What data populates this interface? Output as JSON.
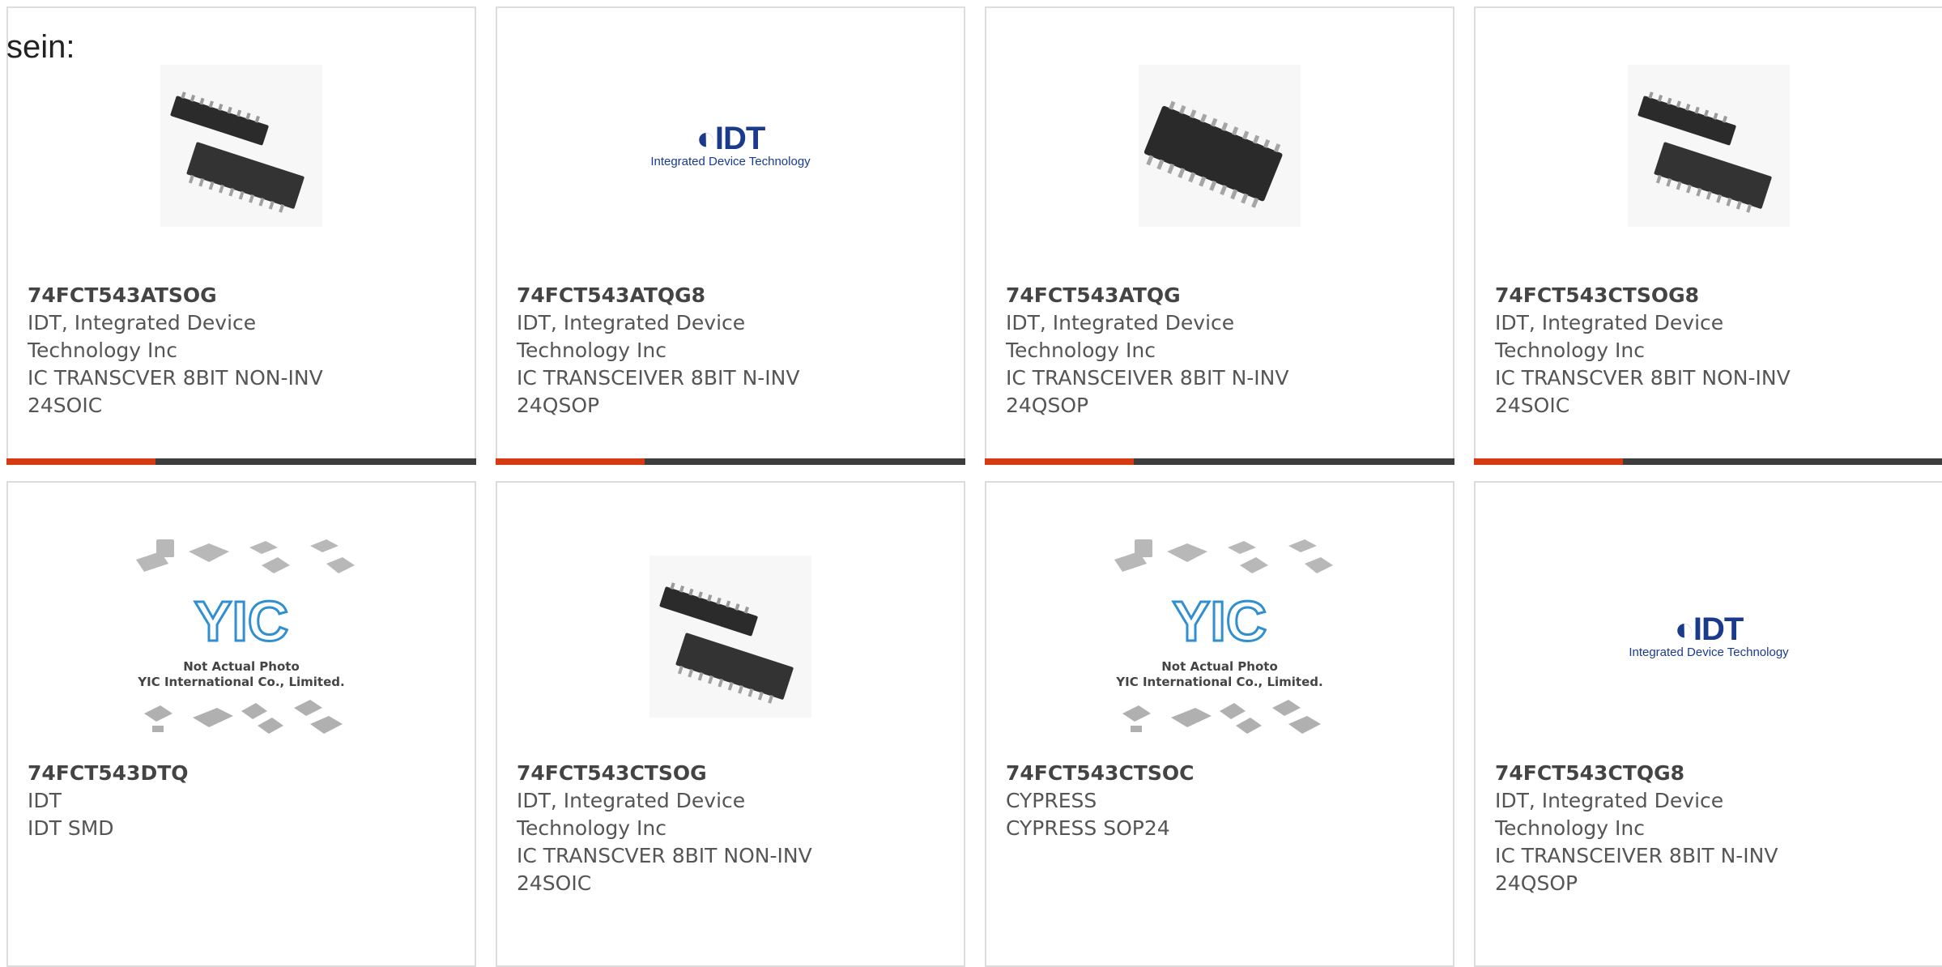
{
  "heading": "sein:",
  "cards": [
    {
      "part": "74FCT543ATSOG",
      "mfr_line1": "IDT, Integrated Device",
      "mfr_line2": "Technology Inc",
      "desc_line1": "IC TRANSCVER 8BIT NON-INV",
      "desc_line2": "24SOIC",
      "image": "chip-photo"
    },
    {
      "part": "74FCT543ATQG8",
      "mfr_line1": "IDT, Integrated Device",
      "mfr_line2": "Technology Inc",
      "desc_line1": "IC TRANSCEIVER 8BIT N-INV",
      "desc_line2": "24QSOP",
      "image": "idt-logo",
      "logo_word": "IDT",
      "logo_sub": "Integrated Device Technology"
    },
    {
      "part": "74FCT543ATQG",
      "mfr_line1": "IDT, Integrated Device",
      "mfr_line2": "Technology Inc",
      "desc_line1": "IC TRANSCEIVER 8BIT N-INV",
      "desc_line2": "24QSOP",
      "image": "chip-photo-single"
    },
    {
      "part": "74FCT543CTSOG8",
      "mfr_line1": "IDT, Integrated Device",
      "mfr_line2": "Technology Inc",
      "desc_line1": "IC TRANSCVER 8BIT NON-INV",
      "desc_line2": "24SOIC",
      "image": "chip-photo"
    },
    {
      "part": "74FCT543DTQ",
      "mfr_line1": "IDT",
      "mfr_line2": "IDT SMD",
      "desc_line1": "",
      "desc_line2": "",
      "image": "placeholder",
      "ph_line1": "Not Actual Photo",
      "ph_line2": "YIC International Co., Limited.",
      "ph_logo": "YIC"
    },
    {
      "part": "74FCT543CTSOG",
      "mfr_line1": "IDT, Integrated Device",
      "mfr_line2": "Technology Inc",
      "desc_line1": "IC TRANSCVER 8BIT NON-INV",
      "desc_line2": "24SOIC",
      "image": "chip-photo"
    },
    {
      "part": "74FCT543CTSOC",
      "mfr_line1": "CYPRESS",
      "mfr_line2": "CYPRESS SOP24",
      "desc_line1": "",
      "desc_line2": "",
      "image": "placeholder",
      "ph_line1": "Not Actual Photo",
      "ph_line2": "YIC International Co., Limited.",
      "ph_logo": "YIC"
    },
    {
      "part": "74FCT543CTQG8",
      "mfr_line1": "IDT, Integrated Device",
      "mfr_line2": "Technology Inc",
      "desc_line1": "IC TRANSCEIVER 8BIT N-INV",
      "desc_line2": "24QSOP",
      "image": "idt-logo",
      "logo_word": "IDT",
      "logo_sub": "Integrated Device Technology"
    }
  ],
  "colors": {
    "accent": "#d63a12",
    "bar": "#3d3d3d",
    "idt_blue": "#1a3a8c",
    "yic_blue": "#2f8fd0"
  }
}
